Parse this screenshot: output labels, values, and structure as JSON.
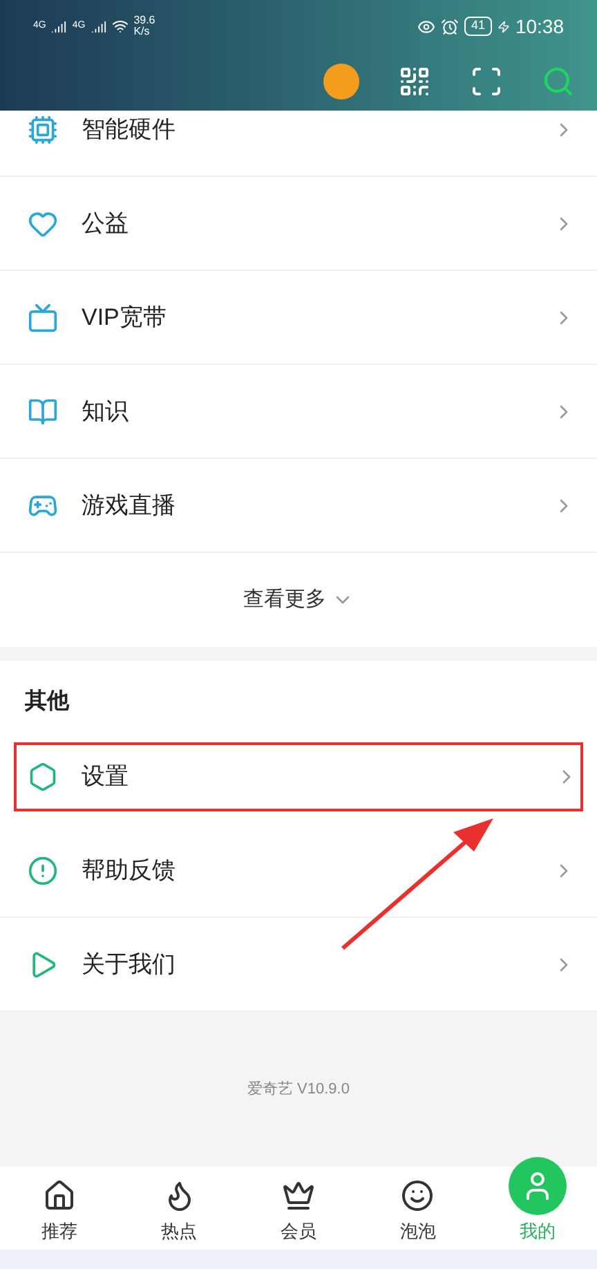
{
  "status_bar": {
    "network_1": "4G",
    "network_2": "4G",
    "speed_value": "39.6",
    "speed_unit": "K/s",
    "battery": "41",
    "time": "10:38"
  },
  "services": [
    {
      "label": "智能硬件",
      "kind": "hardware"
    },
    {
      "label": "公益",
      "kind": "charity"
    },
    {
      "label": "VIP宽带",
      "kind": "broadband"
    },
    {
      "label": "知识",
      "kind": "knowledge"
    },
    {
      "label": "游戏直播",
      "kind": "game"
    }
  ],
  "more_link": "查看更多",
  "other_section": {
    "title": "其他",
    "items": [
      {
        "label": "设置",
        "kind": "settings",
        "highlighted": true
      },
      {
        "label": "帮助反馈",
        "kind": "help",
        "highlighted": false
      },
      {
        "label": "关于我们",
        "kind": "about",
        "highlighted": false
      }
    ]
  },
  "version": "爱奇艺 V10.9.0",
  "annotation_arrow": true,
  "bottom_nav": [
    {
      "label": "推荐",
      "kind": "home",
      "selected": false
    },
    {
      "label": "热点",
      "kind": "hot",
      "selected": false
    },
    {
      "label": "会员",
      "kind": "vip",
      "selected": false
    },
    {
      "label": "泡泡",
      "kind": "bubble",
      "selected": false
    },
    {
      "label": "我的",
      "kind": "me",
      "selected": true
    }
  ]
}
